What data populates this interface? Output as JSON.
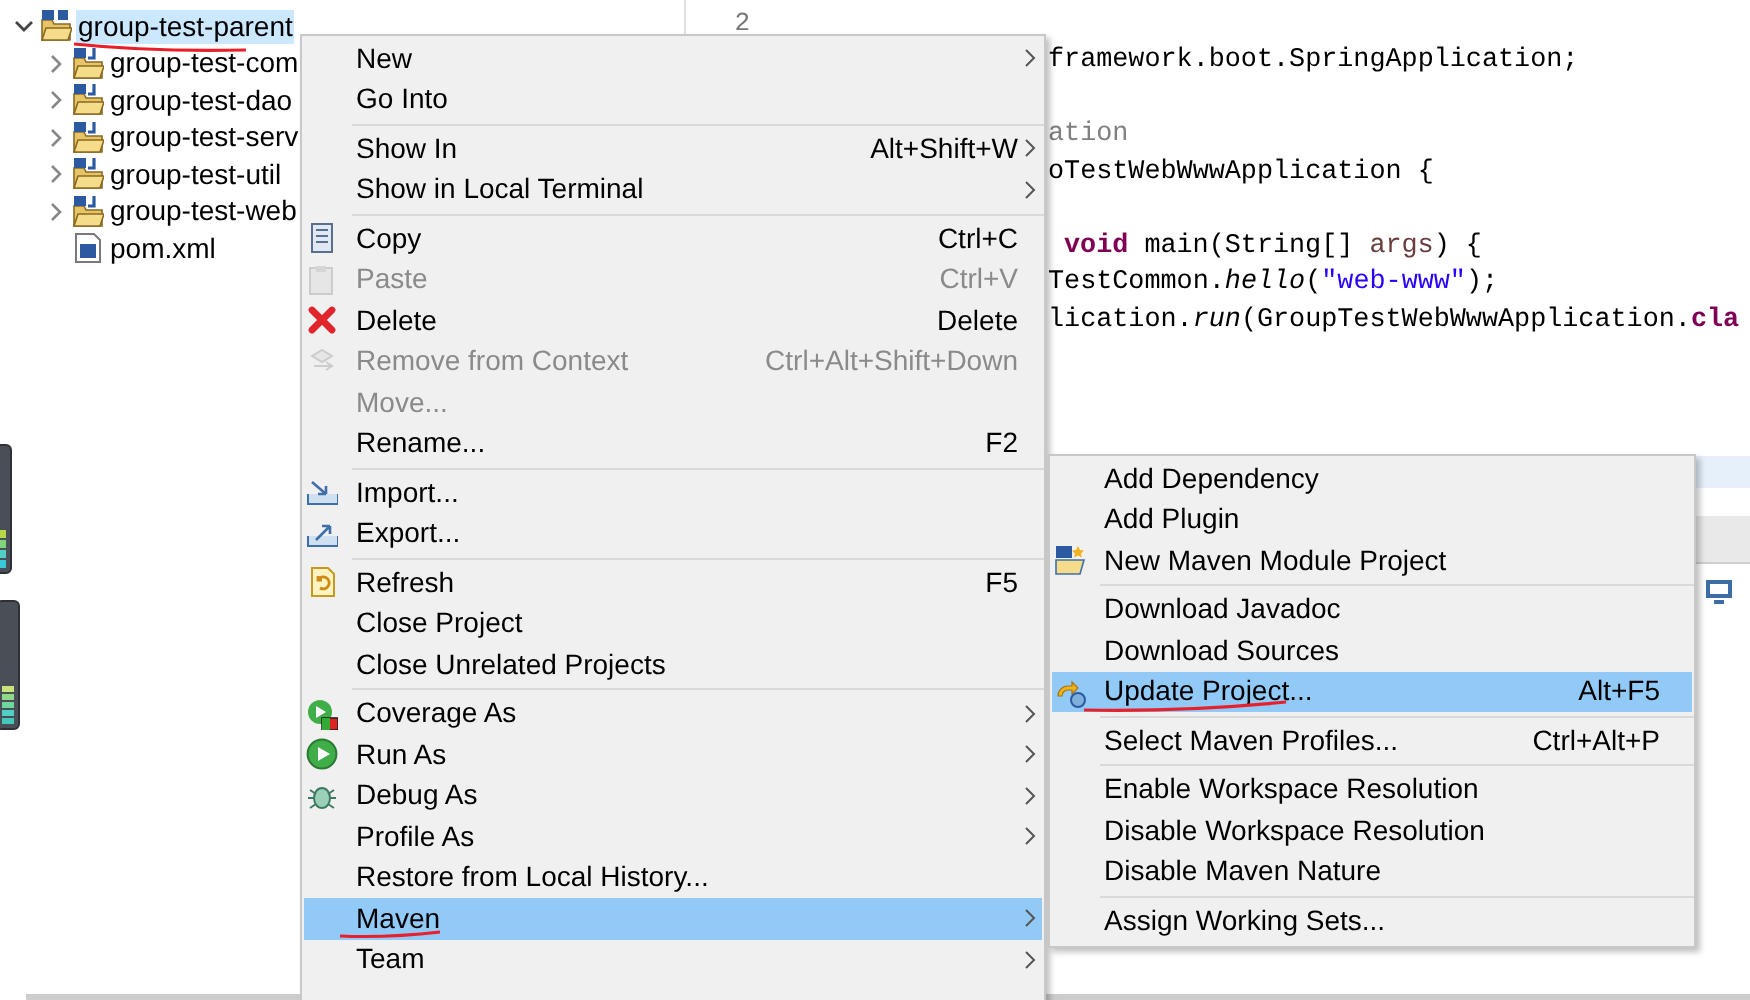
{
  "project_tree": {
    "items": [
      {
        "label": "group-test-parent",
        "kind": "project",
        "selected": true,
        "expanded": true,
        "children": [
          {
            "label": "group-test-com",
            "kind": "module",
            "selected": false,
            "expanded": false
          },
          {
            "label": "group-test-dao",
            "kind": "module",
            "selected": false,
            "expanded": false
          },
          {
            "label": "group-test-serv",
            "kind": "module",
            "selected": false,
            "expanded": false
          },
          {
            "label": "group-test-util",
            "kind": "module",
            "selected": false,
            "expanded": false
          },
          {
            "label": "group-test-web",
            "kind": "module",
            "selected": false,
            "expanded": false
          },
          {
            "label": "pom.xml",
            "kind": "file",
            "selected": false
          }
        ]
      }
    ]
  },
  "editor": {
    "line_numbers": [
      "2"
    ],
    "code_lines": [
      [
        {
          "text": "framework.boot.SpringApplication;",
          "kind": "plain"
        }
      ],
      [
        {
          "text": "ation",
          "kind": "comment"
        }
      ],
      [
        {
          "text": "oTestWebWwwApplication {",
          "kind": "plain"
        }
      ],
      [
        {
          "text": "void",
          "kind": "keyword"
        },
        {
          "text": " main(String[] ",
          "kind": "plain"
        },
        {
          "text": "args",
          "kind": "param"
        },
        {
          "text": ") {",
          "kind": "plain"
        }
      ],
      [
        {
          "text": "TestCommon.",
          "kind": "plain"
        },
        {
          "text": "hello",
          "kind": "method"
        },
        {
          "text": "(",
          "kind": "plain"
        },
        {
          "text": "\"web-www\"",
          "kind": "string"
        },
        {
          "text": ");",
          "kind": "plain"
        }
      ],
      [
        {
          "text": "lication.",
          "kind": "plain"
        },
        {
          "text": "run",
          "kind": "method"
        },
        {
          "text": "(GroupTestWebWwwApplication.",
          "kind": "plain"
        },
        {
          "text": "cla",
          "kind": "keyword"
        }
      ]
    ]
  },
  "context_menu": {
    "items": [
      {
        "kind": "item",
        "label": "New",
        "submenu": true,
        "disabled": false,
        "selected": false
      },
      {
        "kind": "item",
        "label": "Go Into",
        "submenu": false,
        "disabled": false,
        "selected": false
      },
      {
        "kind": "separator"
      },
      {
        "kind": "item",
        "label": "Show In",
        "shortcut": "Alt+Shift+W",
        "submenu": true,
        "disabled": false,
        "selected": false
      },
      {
        "kind": "item",
        "label": "Show in Local Terminal",
        "submenu": true,
        "disabled": false,
        "selected": false
      },
      {
        "kind": "separator"
      },
      {
        "kind": "item",
        "label": "Copy",
        "shortcut": "Ctrl+C",
        "submenu": false,
        "disabled": false,
        "selected": false
      },
      {
        "kind": "item",
        "label": "Paste",
        "shortcut": "Ctrl+V",
        "submenu": false,
        "disabled": true,
        "selected": false
      },
      {
        "kind": "item",
        "label": "Delete",
        "shortcut": "Delete",
        "submenu": false,
        "disabled": false,
        "selected": false
      },
      {
        "kind": "item",
        "label": "Remove from Context",
        "shortcut": "Ctrl+Alt+Shift+Down",
        "submenu": false,
        "disabled": true,
        "selected": false
      },
      {
        "kind": "item",
        "label": "Move...",
        "submenu": false,
        "disabled": true,
        "selected": false
      },
      {
        "kind": "item",
        "label": "Rename...",
        "shortcut": "F2",
        "submenu": false,
        "disabled": false,
        "selected": false
      },
      {
        "kind": "separator"
      },
      {
        "kind": "item",
        "label": "Import...",
        "submenu": false,
        "disabled": false,
        "selected": false
      },
      {
        "kind": "item",
        "label": "Export...",
        "submenu": false,
        "disabled": false,
        "selected": false
      },
      {
        "kind": "separator"
      },
      {
        "kind": "item",
        "label": "Refresh",
        "shortcut": "F5",
        "submenu": false,
        "disabled": false,
        "selected": false
      },
      {
        "kind": "item",
        "label": "Close Project",
        "submenu": false,
        "disabled": false,
        "selected": false
      },
      {
        "kind": "item",
        "label": "Close Unrelated Projects",
        "submenu": false,
        "disabled": false,
        "selected": false
      },
      {
        "kind": "separator"
      },
      {
        "kind": "item",
        "label": "Coverage As",
        "submenu": true,
        "disabled": false,
        "selected": false
      },
      {
        "kind": "item",
        "label": "Run As",
        "submenu": true,
        "disabled": false,
        "selected": false
      },
      {
        "kind": "item",
        "label": "Debug As",
        "submenu": true,
        "disabled": false,
        "selected": false
      },
      {
        "kind": "item",
        "label": "Profile As",
        "submenu": true,
        "disabled": false,
        "selected": false
      },
      {
        "kind": "item",
        "label": "Restore from Local History...",
        "submenu": false,
        "disabled": false,
        "selected": false
      },
      {
        "kind": "item",
        "label": "Maven",
        "submenu": true,
        "disabled": false,
        "selected": true
      },
      {
        "kind": "item",
        "label": "Team",
        "submenu": true,
        "disabled": false,
        "selected": false
      }
    ]
  },
  "maven_submenu": {
    "items": [
      {
        "kind": "item",
        "label": "Add Dependency",
        "submenu": false,
        "disabled": false,
        "selected": false
      },
      {
        "kind": "item",
        "label": "Add Plugin",
        "submenu": false,
        "disabled": false,
        "selected": false
      },
      {
        "kind": "item",
        "label": "New Maven Module Project",
        "submenu": false,
        "disabled": false,
        "selected": false
      },
      {
        "kind": "separator"
      },
      {
        "kind": "item",
        "label": "Download Javadoc",
        "submenu": false,
        "disabled": false,
        "selected": false
      },
      {
        "kind": "item",
        "label": "Download Sources",
        "submenu": false,
        "disabled": false,
        "selected": false
      },
      {
        "kind": "item",
        "label": "Update Project...",
        "shortcut": "Alt+F5",
        "submenu": false,
        "disabled": false,
        "selected": true
      },
      {
        "kind": "separator"
      },
      {
        "kind": "item",
        "label": "Select Maven Profiles...",
        "shortcut": "Ctrl+Alt+P",
        "submenu": false,
        "disabled": false,
        "selected": false
      },
      {
        "kind": "separator"
      },
      {
        "kind": "item",
        "label": "Enable Workspace Resolution",
        "submenu": false,
        "disabled": false,
        "selected": false
      },
      {
        "kind": "item",
        "label": "Disable Workspace Resolution",
        "submenu": false,
        "disabled": false,
        "selected": false
      },
      {
        "kind": "item",
        "label": "Disable Maven Nature",
        "submenu": false,
        "disabled": false,
        "selected": false
      },
      {
        "kind": "separator"
      },
      {
        "kind": "item",
        "label": "Assign Working Sets...",
        "submenu": false,
        "disabled": false,
        "selected": false
      }
    ]
  }
}
